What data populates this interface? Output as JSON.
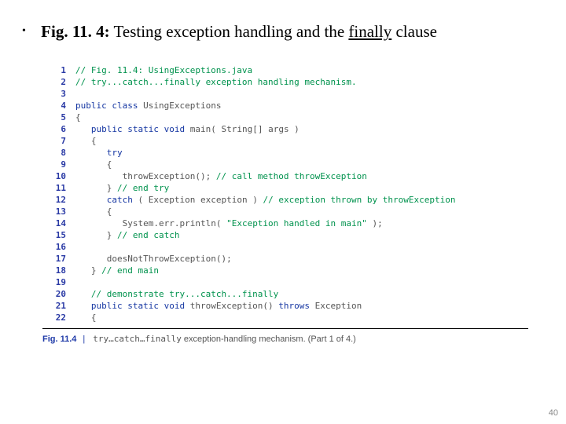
{
  "bullet": {
    "marker": "•",
    "fig_label": "Fig. 11. 4:",
    "text_before": " Testing exception handling and the ",
    "underlined": "finally",
    "text_after": " clause"
  },
  "code": {
    "lines": [
      {
        "n": "1",
        "tokens": [
          {
            "cls": "tok-comment",
            "t": "// Fig. 11.4: UsingExceptions.java"
          }
        ]
      },
      {
        "n": "2",
        "tokens": [
          {
            "cls": "tok-comment",
            "t": "// try...catch...finally exception handling mechanism."
          }
        ]
      },
      {
        "n": "3",
        "tokens": [
          {
            "cls": "",
            "t": ""
          }
        ]
      },
      {
        "n": "4",
        "tokens": [
          {
            "cls": "tok-keyword",
            "t": "public class"
          },
          {
            "cls": "tok-ident",
            "t": " UsingExceptions"
          }
        ]
      },
      {
        "n": "5",
        "tokens": [
          {
            "cls": "tok-punct",
            "t": "{"
          }
        ]
      },
      {
        "n": "6",
        "tokens": [
          {
            "cls": "",
            "t": "   "
          },
          {
            "cls": "tok-keyword",
            "t": "public static void"
          },
          {
            "cls": "tok-ident",
            "t": " main"
          },
          {
            "cls": "tok-punct",
            "t": "( "
          },
          {
            "cls": "tok-type",
            "t": "String[] args"
          },
          {
            "cls": "tok-punct",
            "t": " )"
          }
        ]
      },
      {
        "n": "7",
        "tokens": [
          {
            "cls": "",
            "t": "   "
          },
          {
            "cls": "tok-punct",
            "t": "{"
          }
        ]
      },
      {
        "n": "8",
        "tokens": [
          {
            "cls": "",
            "t": "      "
          },
          {
            "cls": "tok-keyword",
            "t": "try"
          }
        ]
      },
      {
        "n": "9",
        "tokens": [
          {
            "cls": "",
            "t": "      "
          },
          {
            "cls": "tok-punct",
            "t": "{"
          }
        ]
      },
      {
        "n": "10",
        "tokens": [
          {
            "cls": "",
            "t": "         "
          },
          {
            "cls": "tok-ident",
            "t": "throwException();"
          },
          {
            "cls": "tok-comment",
            "t": " // call method throwException"
          }
        ]
      },
      {
        "n": "11",
        "tokens": [
          {
            "cls": "",
            "t": "      "
          },
          {
            "cls": "tok-punct",
            "t": "}"
          },
          {
            "cls": "tok-comment",
            "t": " // end try"
          }
        ]
      },
      {
        "n": "12",
        "tokens": [
          {
            "cls": "",
            "t": "      "
          },
          {
            "cls": "tok-keyword",
            "t": "catch"
          },
          {
            "cls": "tok-punct",
            "t": " ( "
          },
          {
            "cls": "tok-type",
            "t": "Exception exception"
          },
          {
            "cls": "tok-punct",
            "t": " )"
          },
          {
            "cls": "tok-comment",
            "t": " // exception thrown by throwException"
          }
        ]
      },
      {
        "n": "13",
        "tokens": [
          {
            "cls": "",
            "t": "      "
          },
          {
            "cls": "tok-punct",
            "t": "{"
          }
        ]
      },
      {
        "n": "14",
        "tokens": [
          {
            "cls": "",
            "t": "         "
          },
          {
            "cls": "tok-ident",
            "t": "System.err.println("
          },
          {
            "cls": "tok-string",
            "t": " \"Exception handled in main\" "
          },
          {
            "cls": "tok-ident",
            "t": ");"
          }
        ]
      },
      {
        "n": "15",
        "tokens": [
          {
            "cls": "",
            "t": "      "
          },
          {
            "cls": "tok-punct",
            "t": "}"
          },
          {
            "cls": "tok-comment",
            "t": " // end catch"
          }
        ]
      },
      {
        "n": "16",
        "tokens": [
          {
            "cls": "",
            "t": ""
          }
        ]
      },
      {
        "n": "17",
        "tokens": [
          {
            "cls": "",
            "t": "      "
          },
          {
            "cls": "tok-ident",
            "t": "doesNotThrowException();"
          }
        ]
      },
      {
        "n": "18",
        "tokens": [
          {
            "cls": "",
            "t": "   "
          },
          {
            "cls": "tok-punct",
            "t": "}"
          },
          {
            "cls": "tok-comment",
            "t": " // end main"
          }
        ]
      },
      {
        "n": "19",
        "tokens": [
          {
            "cls": "",
            "t": ""
          }
        ]
      },
      {
        "n": "20",
        "tokens": [
          {
            "cls": "",
            "t": "   "
          },
          {
            "cls": "tok-comment",
            "t": "// demonstrate try...catch...finally"
          }
        ]
      },
      {
        "n": "21",
        "tokens": [
          {
            "cls": "",
            "t": "   "
          },
          {
            "cls": "tok-keyword",
            "t": "public static void"
          },
          {
            "cls": "tok-ident",
            "t": " throwException()"
          },
          {
            "cls": "tok-keyword",
            "t": " throws"
          },
          {
            "cls": "tok-type",
            "t": " Exception"
          }
        ]
      },
      {
        "n": "22",
        "tokens": [
          {
            "cls": "",
            "t": "   "
          },
          {
            "cls": "tok-punct",
            "t": "{"
          }
        ]
      }
    ]
  },
  "caption": {
    "label": "Fig. 11.4",
    "sep": "|",
    "mono": "try…catch…finally",
    "rest": " exception-handling mechanism. (Part 1 of 4.)"
  },
  "page_number": "40"
}
